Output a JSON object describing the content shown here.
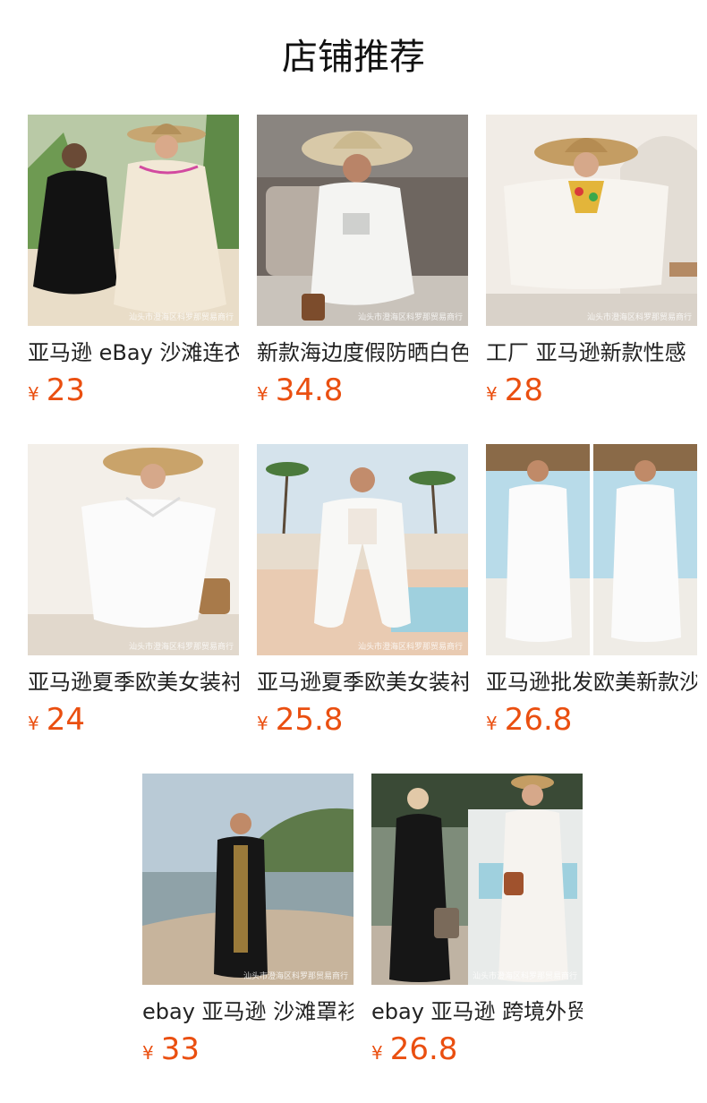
{
  "page": {
    "title": "店铺推荐"
  },
  "currency_symbol": "¥",
  "products": [
    {
      "name": "亚马逊 eBay 沙滩连衣裙",
      "price": "23",
      "watermark": "汕头市澄海区科罗那贸易商行"
    },
    {
      "name": "新款海边度假防晒白色",
      "price": "34.8",
      "watermark": "汕头市澄海区科罗那贸易商行"
    },
    {
      "name": "工厂 亚马逊新款性感",
      "price": "28",
      "watermark": "汕头市澄海区科罗那贸易商行"
    },
    {
      "name": "亚马逊夏季欧美女装衬",
      "price": "24",
      "watermark": "汕头市澄海区科罗那贸易商行"
    },
    {
      "name": "亚马逊夏季欧美女装衬",
      "price": "25.8",
      "watermark": "汕头市澄海区科罗那贸易商行"
    },
    {
      "name": "亚马逊批发欧美新款沙",
      "price": "26.8",
      "watermark": ""
    },
    {
      "name": "ebay 亚马逊 沙滩罩衫",
      "price": "33",
      "watermark": "汕头市澄海区科罗那贸易商行"
    },
    {
      "name": "ebay 亚马逊 跨境外贸",
      "price": "26.8",
      "watermark": "汕头市澄海区科罗那贸易商行"
    }
  ]
}
